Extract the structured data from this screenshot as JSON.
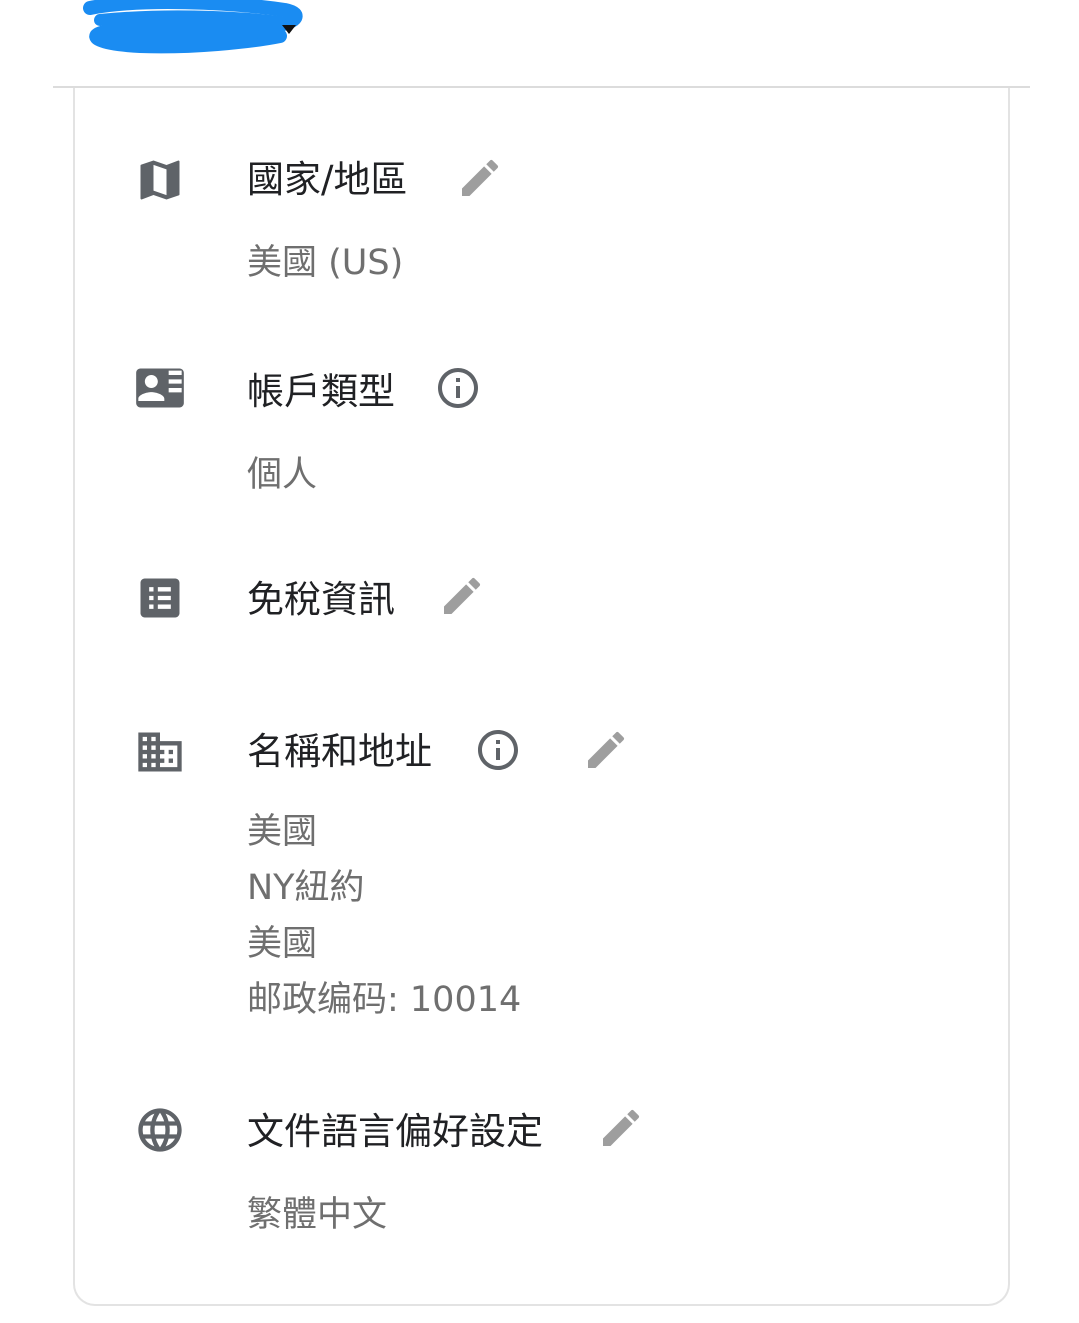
{
  "colors": {
    "title_text": "#202124",
    "value_text": "#6f6f6f",
    "icon": "#5f6368",
    "action_icon": "#9e9e9e",
    "redaction": "#1a8cf2"
  },
  "sections": {
    "country": {
      "icon": "map-icon",
      "title": "國家/地區",
      "value": "美國 (US)",
      "action": "edit-pencil-icon"
    },
    "account_type": {
      "icon": "contact-card-icon",
      "title": "帳戶類型",
      "value": "個人",
      "action": "info-icon"
    },
    "tax_info": {
      "icon": "list-icon",
      "title": "免稅資訊",
      "action": "edit-pencil-icon"
    },
    "name_address": {
      "icon": "building-icon",
      "title": "名稱和地址",
      "address_lines": [
        "美國",
        "NY紐約",
        "美國",
        "邮政编码: 10014"
      ],
      "actions": [
        "info-icon",
        "edit-pencil-icon"
      ]
    },
    "document_language": {
      "icon": "globe-icon",
      "title": "文件語言偏好設定",
      "value": "繁體中文",
      "action": "edit-pencil-icon"
    }
  }
}
